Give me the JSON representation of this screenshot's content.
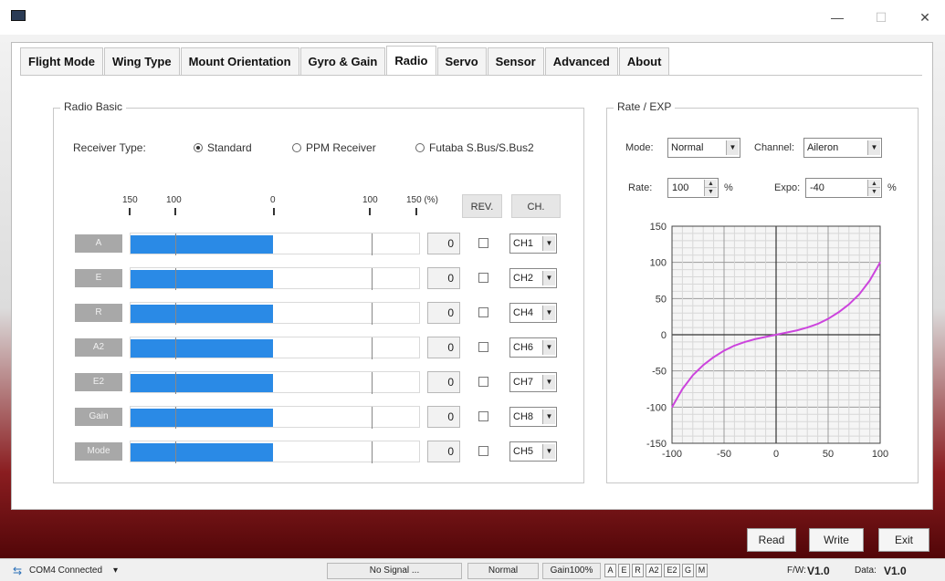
{
  "window": {
    "title": "",
    "minimize": "—",
    "maximize": "☐",
    "close": "✕"
  },
  "tabs": [
    {
      "label": "Flight Mode",
      "active": false
    },
    {
      "label": "Wing Type",
      "active": false
    },
    {
      "label": "Mount Orientation",
      "active": false
    },
    {
      "label": "Gyro & Gain",
      "active": false
    },
    {
      "label": "Radio",
      "active": true
    },
    {
      "label": "Servo",
      "active": false
    },
    {
      "label": "Sensor",
      "active": false
    },
    {
      "label": "Advanced",
      "active": false
    },
    {
      "label": "About",
      "active": false
    }
  ],
  "radio_basic": {
    "title": "Radio Basic",
    "receiver_type_label": "Receiver Type:",
    "receiver_options": [
      {
        "label": "Standard",
        "selected": true
      },
      {
        "label": "PPM Receiver",
        "selected": false
      },
      {
        "label": "Futaba S.Bus/S.Bus2",
        "selected": false
      }
    ],
    "scale": [
      "150",
      "100",
      "0",
      "100",
      "150 (%)"
    ],
    "rev_header": "REV.",
    "ch_header": "CH.",
    "channels": [
      {
        "label": "A",
        "value": "0",
        "rev": false,
        "channel": "CH1"
      },
      {
        "label": "E",
        "value": "0",
        "rev": false,
        "channel": "CH2"
      },
      {
        "label": "R",
        "value": "0",
        "rev": false,
        "channel": "CH4"
      },
      {
        "label": "A2",
        "value": "0",
        "rev": false,
        "channel": "CH6"
      },
      {
        "label": "E2",
        "value": "0",
        "rev": false,
        "channel": "CH7"
      },
      {
        "label": "Gain",
        "value": "0",
        "rev": false,
        "channel": "CH8"
      },
      {
        "label": "Mode",
        "value": "0",
        "rev": false,
        "channel": "CH5"
      }
    ]
  },
  "rate_exp": {
    "title": "Rate / EXP",
    "mode_label": "Mode:",
    "mode_value": "Normal",
    "channel_label": "Channel:",
    "channel_value": "Aileron",
    "rate_label": "Rate:",
    "rate_value": "100",
    "expo_label": "Expo:",
    "expo_value": "-40",
    "percent": "%"
  },
  "chart_data": {
    "type": "line",
    "title": "",
    "xlabel": "",
    "ylabel": "",
    "xlim": [
      -100,
      100
    ],
    "ylim": [
      -150,
      150
    ],
    "x_ticks": [
      "-100",
      "-50",
      "0",
      "50",
      "100"
    ],
    "y_ticks": [
      "150",
      "100",
      "50",
      "0",
      "-50",
      "-100",
      "-150"
    ],
    "grid": true,
    "series": [
      {
        "color": "#cc44dd",
        "x": [
          -100,
          -90,
          -80,
          -70,
          -60,
          -50,
          -40,
          -30,
          -20,
          -10,
          0,
          10,
          20,
          30,
          40,
          50,
          60,
          70,
          80,
          90,
          100
        ],
        "y": [
          -100,
          -75,
          -56,
          -42,
          -31,
          -22,
          -15,
          -10,
          -6,
          -3,
          0,
          3,
          6,
          10,
          15,
          22,
          31,
          42,
          56,
          75,
          100
        ]
      }
    ]
  },
  "buttons": {
    "read": "Read",
    "write": "Write",
    "exit": "Exit"
  },
  "status": {
    "connection": "COM4 Connected",
    "dropdown": "▾",
    "signal": "No Signal ...",
    "mode": "Normal",
    "gain": "Gain100%",
    "indicators": [
      "A",
      "E",
      "R",
      "A2",
      "E2",
      "G",
      "M"
    ],
    "fw_label": "F/W:",
    "fw_version": "V1.0",
    "data_label": "Data:",
    "data_version": "V1.0"
  },
  "colors": {
    "bar": "#2a8ae6",
    "curve": "#cc44dd",
    "channel_label_bg": "#a8a8a8"
  }
}
